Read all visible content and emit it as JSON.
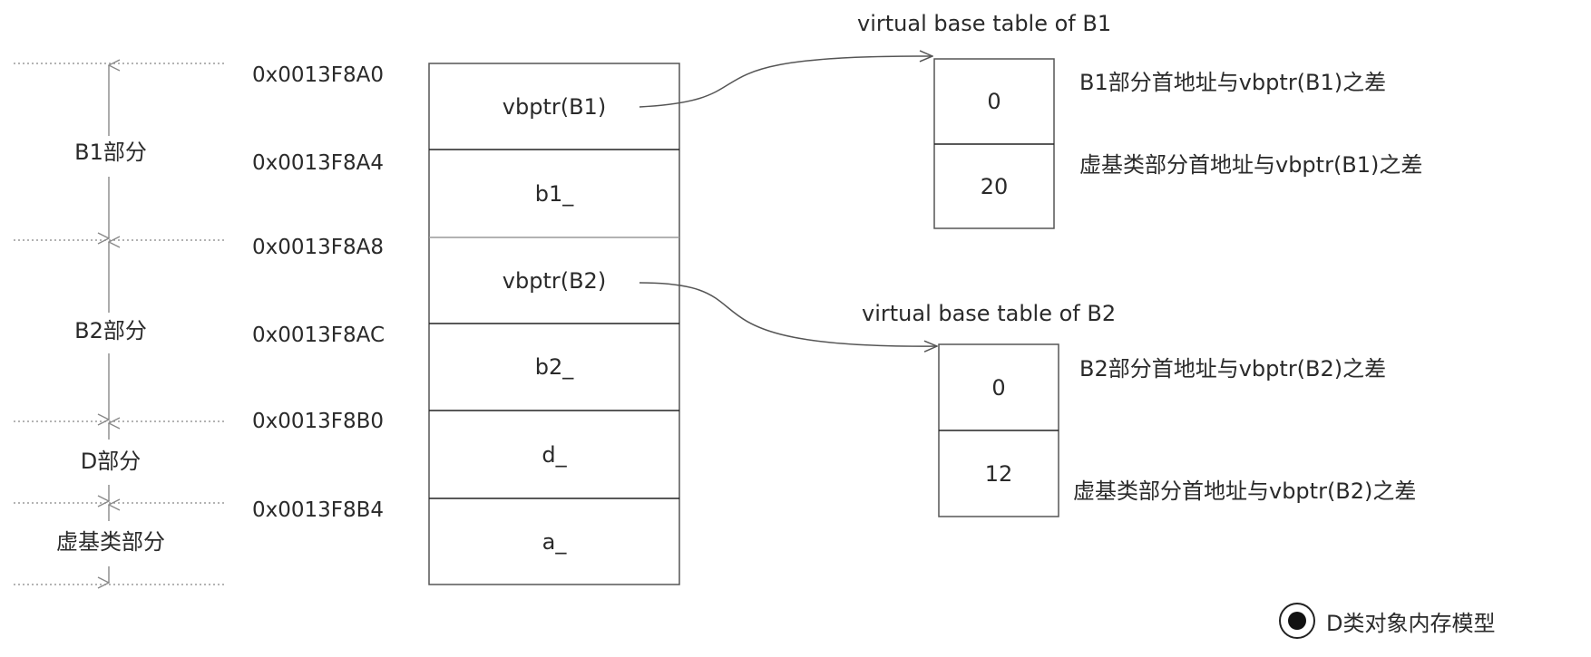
{
  "sections": [
    "B1部分",
    "B2部分",
    "D部分",
    "虚基类部分"
  ],
  "addresses": [
    "0x0013F8A0",
    "0x0013F8A4",
    "0x0013F8A8",
    "0x0013F8AC",
    "0x0013F8B0",
    "0x0013F8B4"
  ],
  "memory_cells": [
    "vbptr(B1)",
    "b1_",
    "vbptr(B2)",
    "b2_",
    "d_",
    "a_"
  ],
  "vbtable_b1": {
    "title": "virtual base table of B1",
    "values": [
      "0",
      "20"
    ],
    "notes": [
      "B1部分首地址与vbptr(B1)之差",
      "虚基类部分首地址与vbptr(B1)之差"
    ]
  },
  "vbtable_b2": {
    "title": "virtual base table of B2",
    "values": [
      "0",
      "12"
    ],
    "notes": [
      "B2部分首地址与vbptr(B2)之差",
      "虚基类部分首地址与vbptr(B2)之差"
    ]
  },
  "legend": "D类对象内存模型"
}
